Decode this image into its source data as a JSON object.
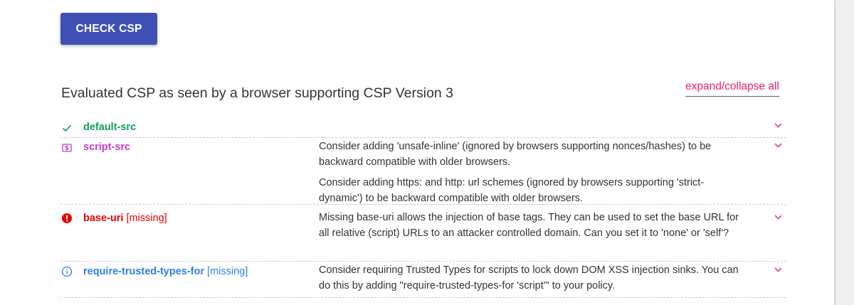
{
  "check_button": {
    "label": "CHECK CSP"
  },
  "evaluated_title": "Evaluated CSP as seen by a browser supporting CSP Version 3",
  "expand_all": {
    "label": "expand/collapse all"
  },
  "colors": {
    "accent": "#3f51b5",
    "link": "#e91e63",
    "ok": "#0f9d58",
    "medium_severity": "#c13cc8",
    "high_severity": "#ea0000",
    "info": "#2f80e6"
  },
  "directives": [
    {
      "name": "default-src",
      "missing": "",
      "icon": "check-icon",
      "findings": []
    },
    {
      "name": "script-src",
      "missing": "",
      "icon": "dollar-box-icon",
      "findings": [
        "Consider adding 'unsafe-inline' (ignored by browsers supporting nonces/hashes) to be backward compatible with older browsers.",
        "Consider adding https: and http: url schemes (ignored by browsers supporting 'strict-dynamic') to be backward compatible with older browsers."
      ]
    },
    {
      "name": "base-uri",
      "missing": "[missing]",
      "icon": "error-icon",
      "findings": [
        "Missing base-uri allows the injection of base tags. They can be used to set the base URL for all relative (script) URLs to an attacker controlled domain. Can you set it to 'none' or 'self'?"
      ]
    },
    {
      "name": "require-trusted-types-for",
      "missing": "[missing]",
      "icon": "info-icon",
      "findings": [
        "Consider requiring Trusted Types for scripts to lock down DOM XSS injection sinks. You can do this by adding \"require-trusted-types-for 'script'\" to your policy."
      ]
    }
  ]
}
